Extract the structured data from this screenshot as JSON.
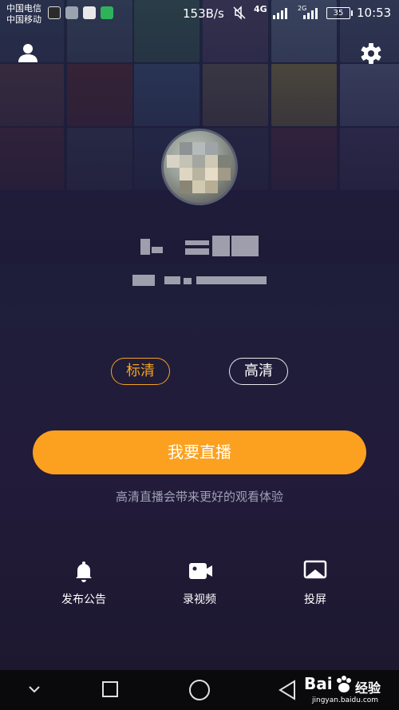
{
  "status_bar": {
    "carrier_1": "中国电信",
    "carrier_2": "中国移动",
    "net_speed": "153B/s",
    "network_1": "4G",
    "network_2": "2G",
    "battery": "35",
    "time": "10:53"
  },
  "main": {
    "quality_standard": "标清",
    "quality_hd": "高清",
    "selected_quality": "标清",
    "go_live_label": "我要直播",
    "hint": "高清直播会带来更好的观看体验"
  },
  "actions": [
    {
      "label": "发布公告",
      "icon": "bell-icon"
    },
    {
      "label": "录视频",
      "icon": "video-camera-icon"
    },
    {
      "label": "投屏",
      "icon": "screen-cast-icon"
    }
  ],
  "watermark": {
    "brand_a": "Bai",
    "brand_b": "经验",
    "url": "jingyan.baidu.com"
  },
  "colors": {
    "accent": "#fca11f",
    "background": "#1e1b38"
  }
}
